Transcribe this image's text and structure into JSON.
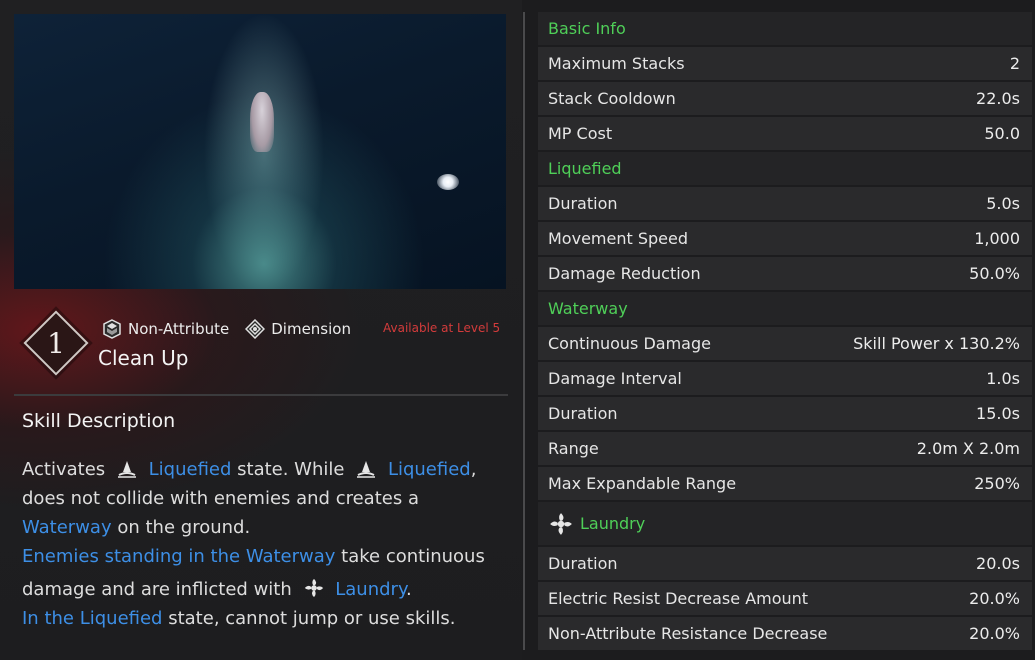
{
  "skill": {
    "level": "1",
    "attribute": "Non-Attribute",
    "type": "Dimension",
    "availability": "Available at Level 5",
    "name": "Clean Up"
  },
  "description": {
    "title": "Skill Description",
    "line1": {
      "t1": "Activates",
      "h1": "Liquefied",
      "t2": "state. While",
      "h2": "Liquefied",
      "t3": ","
    },
    "line2": "does not collide with enemies and creates a",
    "line3": {
      "h1": "Waterway",
      "t1": "on the ground."
    },
    "line4": {
      "h1": "Enemies standing in the Waterway",
      "t1": "take continuous"
    },
    "line5": {
      "t1": "damage and are inflicted with",
      "h1": "Laundry",
      "t2": "."
    },
    "line6": {
      "h1": "In the Liquefied",
      "t1": "state, cannot jump or use skills."
    }
  },
  "stats": [
    {
      "label": "Basic Info",
      "header": true
    },
    {
      "label": "Maximum Stacks",
      "value": "2"
    },
    {
      "label": "Stack Cooldown",
      "value": "22.0s"
    },
    {
      "label": "MP Cost",
      "value": "50.0"
    },
    {
      "label": "Liquefied",
      "header": true
    },
    {
      "label": "Duration",
      "value": "5.0s"
    },
    {
      "label": "Movement Speed",
      "value": "1,000"
    },
    {
      "label": "Damage Reduction",
      "value": "50.0%"
    },
    {
      "label": "Waterway",
      "header": true
    },
    {
      "label": "Continuous Damage",
      "value": "Skill Power x 130.2%"
    },
    {
      "label": "Damage Interval",
      "value": "1.0s"
    },
    {
      "label": "Duration",
      "value": "15.0s"
    },
    {
      "label": "Range",
      "value": "2.0m X 2.0m"
    },
    {
      "label": "Max Expandable Range",
      "value": "250%"
    },
    {
      "label": "Laundry",
      "header": true,
      "icon": "laundry-icon"
    },
    {
      "label": "Duration",
      "value": "20.0s"
    },
    {
      "label": "Electric Resist Decrease Amount",
      "value": "20.0%"
    },
    {
      "label": "Non-Attribute Resistance Decrease",
      "value": "20.0%"
    }
  ],
  "colors": {
    "header": "#4fcf58",
    "highlight": "#3d8fe6",
    "availability": "#d23b3b"
  }
}
